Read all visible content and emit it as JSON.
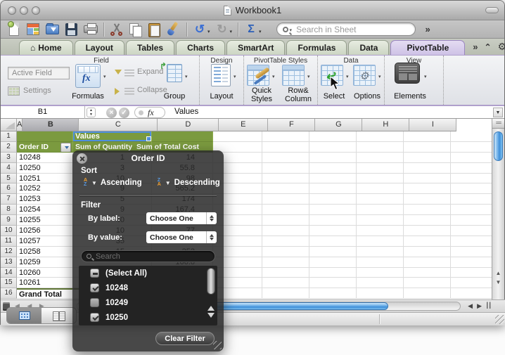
{
  "glyphs": {
    "caret": "▾",
    "up": "▲",
    "down": "▼",
    "left": "◀",
    "right": "▶",
    "double_chevron": "»",
    "collapse": "⌃",
    "gear": "⚙",
    "undo": "↺",
    "redo": "↻",
    "sigma": "Σ",
    "fx": "fx",
    "cancel": "×",
    "accept": "✓",
    "split": "==",
    "nav_arrows": "◀ ◀ ▶",
    "pause": "||"
  },
  "titlebar": {
    "title": "Workbook1"
  },
  "toolbar": {
    "search_placeholder": "Search in Sheet"
  },
  "tabs": [
    {
      "label": "Home",
      "icon": "⌂",
      "state": ""
    },
    {
      "label": "Layout",
      "state": ""
    },
    {
      "label": "Tables",
      "state": ""
    },
    {
      "label": "Charts",
      "state": ""
    },
    {
      "label": "SmartArt",
      "state": ""
    },
    {
      "label": "Formulas",
      "state": ""
    },
    {
      "label": "Data",
      "state": ""
    },
    {
      "label": "PivotTable",
      "state": "active"
    }
  ],
  "ribbon": {
    "groups": {
      "field": "Field",
      "design": "Design",
      "styles": "PivotTable Styles",
      "data": "Data",
      "view": "View"
    },
    "active_field": "Active Field",
    "settings": "Settings",
    "formulas": "Formulas",
    "expand": "Expand",
    "collapse": "Collapse",
    "group": "Group",
    "layout": "Layout",
    "quick_styles_1": "Quick",
    "quick_styles_2": "Styles",
    "row_column_1": "Row&",
    "row_column_2": "Column",
    "select": "Select",
    "options": "Options",
    "elements": "Elements",
    "group_arrow": "↱",
    "select_arrow": "↩"
  },
  "formula_bar": {
    "name_box": "B1",
    "content": "Values"
  },
  "grid": {
    "columns": [
      {
        "label": "A",
        "state": ""
      },
      {
        "label": "B",
        "state": "selected"
      },
      {
        "label": "C",
        "state": ""
      },
      {
        "label": "D",
        "state": ""
      },
      {
        "label": "E",
        "state": ""
      },
      {
        "label": "F",
        "state": ""
      },
      {
        "label": "G",
        "state": ""
      },
      {
        "label": "H",
        "state": ""
      },
      {
        "label": "I",
        "state": ""
      }
    ],
    "rows": [
      {
        "n": "1",
        "a": "",
        "b": "Values",
        "c": "",
        "kind": "kind-hdr1"
      },
      {
        "n": "2",
        "a": "Order ID",
        "b": "Sum of Quantity",
        "c": "Sum of Total Cost",
        "kind": "kind-hdr2"
      },
      {
        "n": "3",
        "a": "10248",
        "b": "1",
        "c": "14",
        "kind": "kind-data"
      },
      {
        "n": "4",
        "a": "10250",
        "b": "3",
        "c": "55.8",
        "kind": "kind-data"
      },
      {
        "n": "5",
        "a": "10251",
        "b": "10",
        "c": "98",
        "kind": "kind-data"
      },
      {
        "n": "6",
        "a": "10252",
        "b": "9",
        "c": "565.2",
        "kind": "kind-data"
      },
      {
        "n": "7",
        "a": "10253",
        "b": "5",
        "c": "174",
        "kind": "kind-data"
      },
      {
        "n": "8",
        "a": "10254",
        "b": "9",
        "c": "167.4",
        "kind": "kind-data"
      },
      {
        "n": "9",
        "a": "10255",
        "b": "40",
        "c": "1696",
        "kind": "kind-data"
      },
      {
        "n": "10",
        "a": "10256",
        "b": "10",
        "c": "77",
        "kind": "kind-data"
      },
      {
        "n": "11",
        "a": "10257",
        "b": "35",
        "c": "1484",
        "kind": "kind-data"
      },
      {
        "n": "12",
        "a": "10258",
        "b": "15",
        "c": "252",
        "kind": "kind-data"
      },
      {
        "n": "13",
        "a": "10259",
        "b": "",
        "c": "100.8",
        "kind": "kind-data"
      },
      {
        "n": "14",
        "a": "10260",
        "b": "",
        "c": "",
        "kind": "kind-data"
      },
      {
        "n": "15",
        "a": "10261",
        "b": "",
        "c": "",
        "kind": "kind-data"
      },
      {
        "n": "16",
        "a": "Grand Total",
        "b": "",
        "c": "",
        "kind": "kind-total"
      }
    ]
  },
  "popup": {
    "title": "Order ID",
    "sort_label": "Sort",
    "ascending": "Ascending",
    "descending": "Descending",
    "az_top": "A",
    "az_bottom": "Z",
    "za_top": "Z",
    "za_bottom": "A",
    "filter_label": "Filter",
    "by_label": "By label:",
    "by_value": "By value:",
    "choose_one_label": "Choose One",
    "choose_one_value": "Choose One",
    "search_placeholder": "Search",
    "items": [
      {
        "label": "(Select All)",
        "state": "indeterminate"
      },
      {
        "label": "10248",
        "state": "checked"
      },
      {
        "label": "10249",
        "state": "unchecked"
      },
      {
        "label": "10250",
        "state": "checked"
      }
    ],
    "clear_filter": "Clear Filter"
  },
  "statusbar": {
    "view_label": "Normal View"
  }
}
